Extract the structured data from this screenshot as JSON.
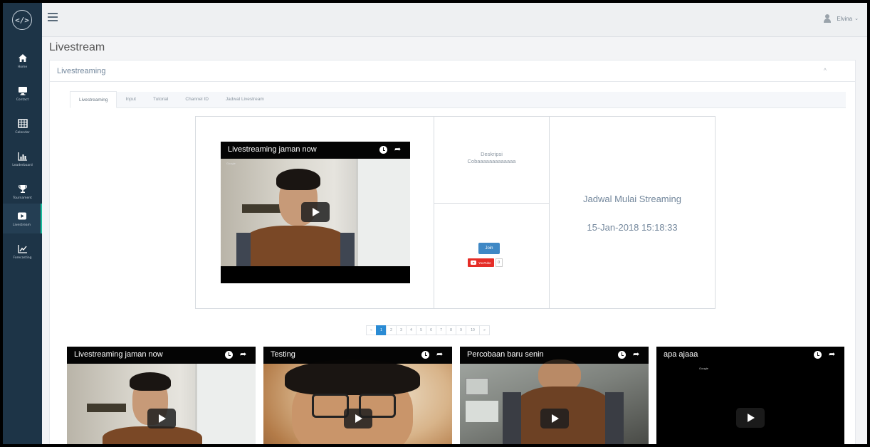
{
  "sidebar": {
    "logo": "</>",
    "items": [
      {
        "label": "Home",
        "icon": "home-icon"
      },
      {
        "label": "Contact",
        "icon": "monitor-icon"
      },
      {
        "label": "Calendar",
        "icon": "calendar-icon"
      },
      {
        "label": "Leaderboard",
        "icon": "bar-chart-icon"
      },
      {
        "label": "Tournament",
        "icon": "trophy-icon"
      },
      {
        "label": "Livestream",
        "icon": "play-square-icon"
      },
      {
        "label": "Forecasting",
        "icon": "line-chart-icon"
      }
    ]
  },
  "topbar": {
    "user_name": "Elvina",
    "user_caret": "⌄"
  },
  "page": {
    "title": "Livestream"
  },
  "panel": {
    "title": "Livestreaming",
    "collapse_glyph": "^"
  },
  "tabs": [
    {
      "label": "Livestreaming",
      "active": true
    },
    {
      "label": "Input",
      "active": false
    },
    {
      "label": "Tutorial",
      "active": false
    },
    {
      "label": "Channel ID",
      "active": false
    },
    {
      "label": "Jadwal Livestream",
      "active": false
    }
  ],
  "stream": {
    "video_title": "Livestreaming jaman now",
    "description_label": "Deskripsi",
    "description_text": "Cobaaaaaaaaaaaaa",
    "join_label": "Join",
    "youtube_label": "YouTube",
    "subscriber_count": "0",
    "schedule_title": "Jadwal Mulai Streaming",
    "schedule_date": "15-Jan-2018 15:18:33",
    "watermark": "Google"
  },
  "pagination": {
    "prev": "«",
    "pages": [
      "1",
      "2",
      "3",
      "4",
      "5",
      "6",
      "7",
      "8",
      "9",
      "10"
    ],
    "active_page": "1",
    "next": "»"
  },
  "thumbnails": [
    {
      "title": "Livestreaming jaman now"
    },
    {
      "title": "Testing"
    },
    {
      "title": "Percobaan baru senin"
    },
    {
      "title": "apa ajaaa"
    }
  ],
  "colors": {
    "sidebar": "#1d3447",
    "accent": "#1abc9c",
    "pagination_active": "#2a8bd4",
    "join_button": "#3f88c5",
    "youtube": "#e52d27"
  }
}
